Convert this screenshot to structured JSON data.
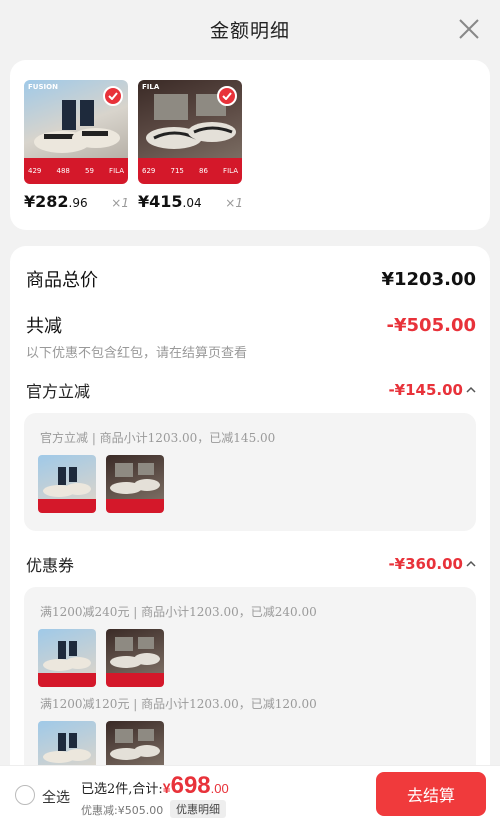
{
  "header": {
    "title": "金额明细"
  },
  "products": [
    {
      "brand": "FUSION",
      "bar_left": "429",
      "bar_mid": "488",
      "bar_right": "59",
      "bar_logo": "FILA",
      "price_int": "¥282",
      "price_dec": ".96",
      "qty": "×1"
    },
    {
      "brand": "FILA",
      "bar_left": "629",
      "bar_mid": "715",
      "bar_right": "86",
      "bar_logo": "FILA",
      "price_int": "¥415",
      "price_dec": ".04",
      "qty": "×1"
    }
  ],
  "summary": {
    "total_label": "商品总价",
    "total_value": "¥1203.00",
    "reduce_label": "共减",
    "reduce_value": "-¥505.00",
    "reduce_note": "以下优惠不包含红包，请在结算页查看"
  },
  "official": {
    "label": "官方立减",
    "value": "-¥145.00",
    "detail": "官方立减 | 商品小计1203.00，已减145.00"
  },
  "coupon": {
    "label": "优惠券",
    "value": "-¥360.00",
    "detail1": "满1200减240元 | 商品小计1203.00，已减240.00",
    "detail2": "满1200减120元 | 商品小计1203.00，已减120.00"
  },
  "bottom": {
    "select_all": "全选",
    "selected_text": "已选2件,合计:",
    "currency": "¥",
    "total_int": "698",
    "total_dec": ".00",
    "discount_text": "优惠减:¥505.00",
    "detail_button": "优惠明细",
    "checkout_button": "去结算"
  },
  "colors": {
    "accent_red": "#e8323a",
    "button_red": "#f03a3c",
    "page_bg": "#f2f2f2"
  }
}
